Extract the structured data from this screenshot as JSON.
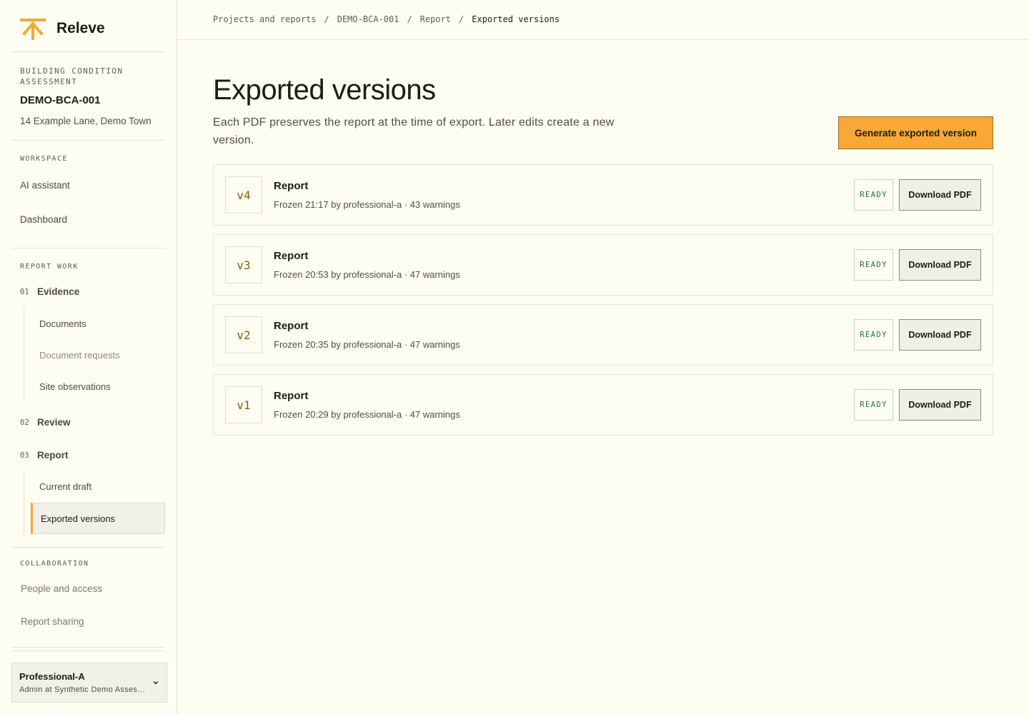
{
  "app": {
    "name": "Releve",
    "accent": "#f8a835",
    "logo_icon": "releve-logo-icon"
  },
  "project": {
    "type": "Building condition assessment",
    "code": "DEMO-BCA-001",
    "address": "14 Example Lane, Demo Town"
  },
  "sidebar": {
    "workspace_label": "Workspace",
    "workspace_items": [
      "AI assistant",
      "Dashboard"
    ],
    "report_work_label": "Report work",
    "steps": [
      {
        "num": "01",
        "label": "Evidence",
        "subitems": [
          "Documents",
          "Document requests",
          "Site observations"
        ]
      },
      {
        "num": "02",
        "label": "Review"
      },
      {
        "num": "03",
        "label": "Report",
        "subitems": [
          "Current draft",
          "Exported versions"
        ]
      }
    ],
    "collab_label": "Collaboration",
    "collab_items": [
      "People and access",
      "Report sharing"
    ]
  },
  "user": {
    "name": "Professional-A",
    "role": "Admin at Synthetic Demo Assessments",
    "menu_icon": "chevron-down-icon"
  },
  "breadcrumb": [
    "Projects and reports",
    "DEMO-BCA-001",
    "Report",
    "Exported versions"
  ],
  "page": {
    "title": "Exported versions",
    "description": "Each PDF preserves the report at the time of export. Later edits create a new version.",
    "generate_label": "Generate exported version"
  },
  "versions": [
    {
      "tag": "v4",
      "title": "Report",
      "meta": "Frozen 21:17 by professional-a · 43 warnings",
      "status": "READY",
      "action": "Download PDF"
    },
    {
      "tag": "v3",
      "title": "Report",
      "meta": "Frozen 20:53 by professional-a · 47 warnings",
      "status": "READY",
      "action": "Download PDF"
    },
    {
      "tag": "v2",
      "title": "Report",
      "meta": "Frozen 20:35 by professional-a · 47 warnings",
      "status": "READY",
      "action": "Download PDF"
    },
    {
      "tag": "v1",
      "title": "Report",
      "meta": "Frozen 20:29 by professional-a · 47 warnings",
      "status": "READY",
      "action": "Download PDF"
    }
  ]
}
